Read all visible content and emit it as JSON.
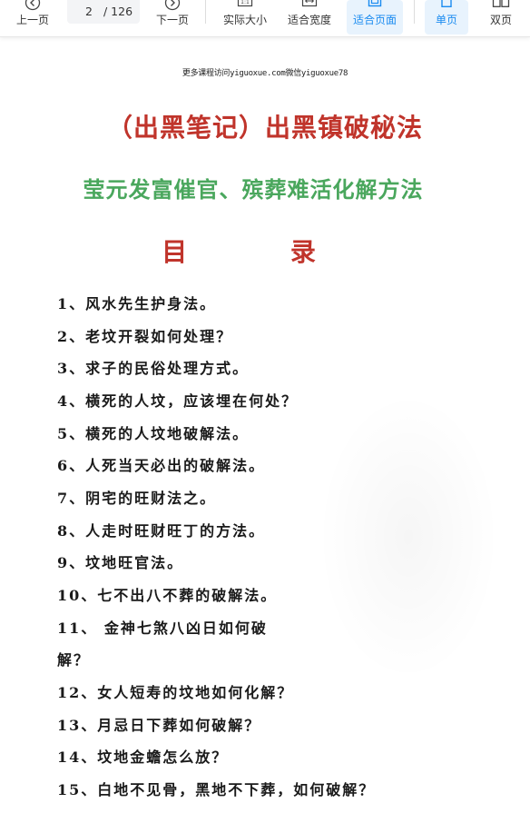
{
  "toolbar": {
    "prev_label": "上一页",
    "page_current": "2",
    "page_total": "/ 126",
    "next_label": "下一页",
    "actual_size_label": "实际大小",
    "fit_width_label": "适合宽度",
    "fit_page_label": "适合页面",
    "single_label": "单页",
    "double_label": "双页",
    "active_color": "#1a8bf0"
  },
  "doc": {
    "watermark": "更多课程访问yiguoxue.com微信yiguoxue78",
    "title": "（出黑笔记）出黑镇破秘法",
    "subtitle": "莹元发富催官、殡葬难活化解方法",
    "toc_heading": "目 录",
    "toc": [
      "1、风水先生护身法。",
      "2、老坟开裂如何处理？",
      "3、求子的民俗处理方式。",
      "4、横死的人坟，应该埋在何处？",
      "5、横死的人坟地破解法。",
      "6、人死当天必出的破解法。",
      "7、阴宅的旺财法之。",
      "8、人走时旺财旺丁的方法。",
      "9、坟地旺官法。",
      "10、七不出八不葬的破解法。",
      "11、 金神七煞八凶日如何破",
      "解？",
      "12、女人短寿的坟地如何化解？",
      "13、月忌日下葬如何破解？",
      "14、坟地金蟾怎么放？",
      "15、白地不见骨，黑地不下葬，如何破解？"
    ]
  }
}
